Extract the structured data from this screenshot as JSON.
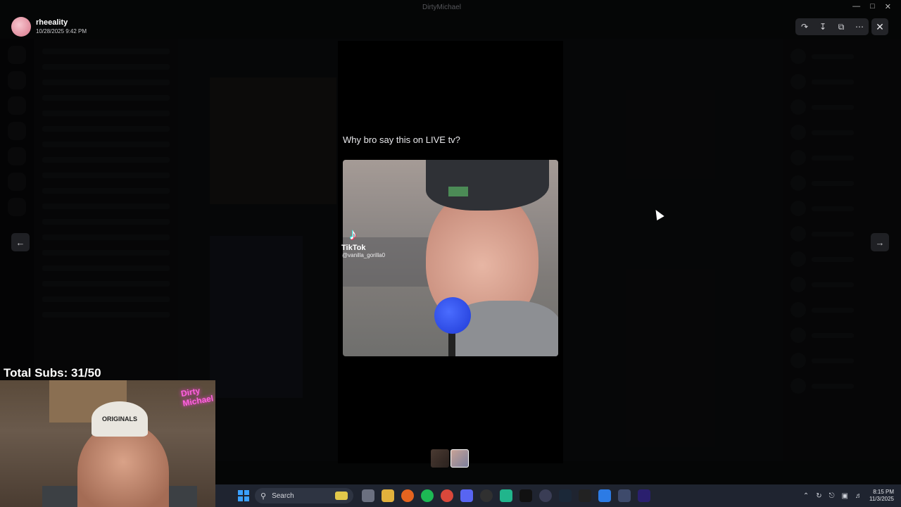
{
  "window": {
    "title": "DirtyMichael"
  },
  "author": {
    "name": "rheeality",
    "timestamp": "10/28/2025 9:42 PM"
  },
  "toolbar": {
    "icons": [
      "forward-icon",
      "download-icon",
      "open-external-icon",
      "more-icon"
    ]
  },
  "embed": {
    "title": "Why bro say this on LIVE tv?",
    "tiktok_label": "TikTok",
    "tiktok_handle": "@vanilla_gorilla0"
  },
  "stream": {
    "subs_text": "Total Subs: 31/50",
    "hat_text": "ORIGINALS",
    "neon_text": "Dirty Michael"
  },
  "taskbar": {
    "search_placeholder": "Search",
    "time": "8:15 PM",
    "date": "11/3/2025"
  }
}
